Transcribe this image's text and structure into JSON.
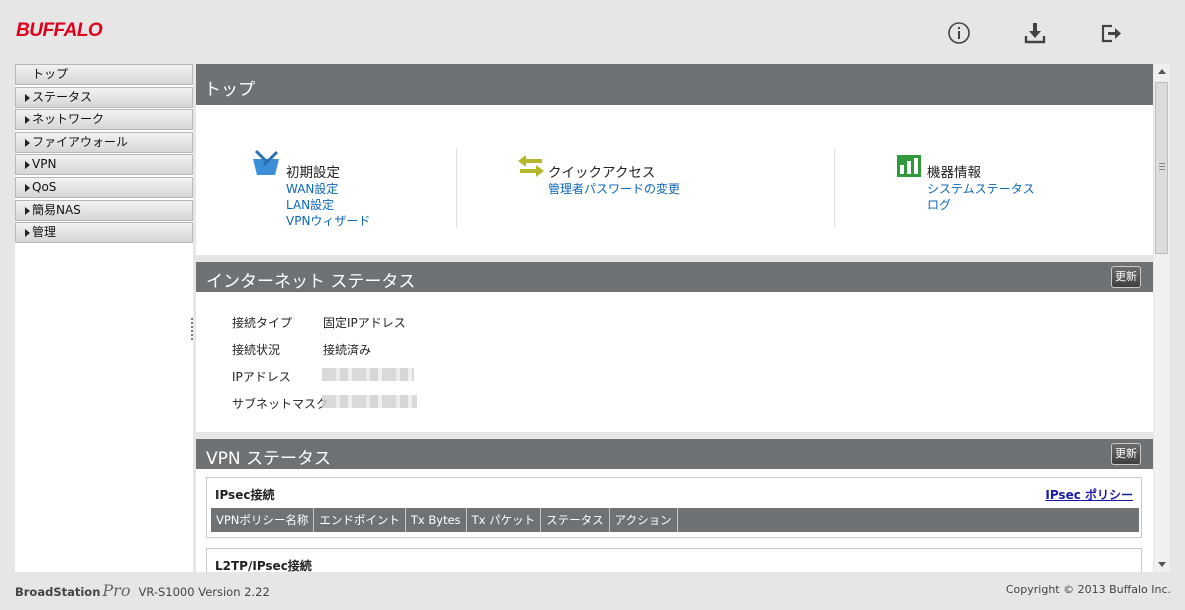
{
  "brand": {
    "logo": "BUFFALO"
  },
  "header_icons": [
    "info-icon",
    "download-icon",
    "logout-icon"
  ],
  "sidebar": {
    "items": [
      {
        "label": "トップ"
      },
      {
        "label": "ステータス"
      },
      {
        "label": "ネットワーク"
      },
      {
        "label": "ファイアウォール"
      },
      {
        "label": "VPN"
      },
      {
        "label": "QoS"
      },
      {
        "label": "簡易NAS"
      },
      {
        "label": "管理"
      }
    ]
  },
  "top": {
    "title": "トップ",
    "groups": [
      {
        "title": "初期設定",
        "icon": "tools-icon",
        "links": [
          "WAN設定",
          "LAN設定",
          "VPNウィザード"
        ]
      },
      {
        "title": "クイックアクセス",
        "icon": "arrows-icon",
        "links": [
          "管理者パスワードの変更"
        ]
      },
      {
        "title": "機器情報",
        "icon": "bar-chart-icon",
        "links": [
          "システムステータス",
          "ログ"
        ]
      }
    ]
  },
  "internet": {
    "title": "インターネット ステータス",
    "update_label": "更新",
    "rows": [
      {
        "label": "接続タイプ",
        "value": "固定IPアドレス"
      },
      {
        "label": "接続状況",
        "value": "接続済み"
      },
      {
        "label": "IPアドレス",
        "value": ""
      },
      {
        "label": "サブネットマスク",
        "value": ""
      }
    ]
  },
  "vpn": {
    "title": "VPN ステータス",
    "update_label": "更新",
    "ipsec": {
      "title": "IPsec接続",
      "policy_link": "IPsec ポリシー",
      "columns": [
        "VPNポリシー名称",
        "エンドポイント",
        "Tx Bytes",
        "Tx パケット",
        "ステータス",
        "アクション"
      ]
    },
    "l2tp": {
      "title": "L2TP/IPsec接続"
    }
  },
  "footer": {
    "product": "BroadStation",
    "product_suffix": "Pro",
    "version": "VR-S1000 Version 2.22",
    "copyright": "Copyright © 2013 Buffalo Inc."
  }
}
